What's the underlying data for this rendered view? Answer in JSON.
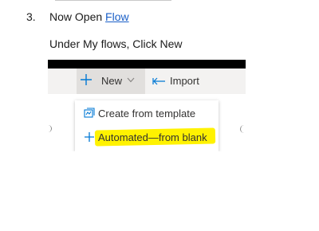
{
  "step": {
    "number": "3.",
    "text_before_link": "Now Open ",
    "link_text": "Flow"
  },
  "instruction": "Under My flows, Click New",
  "screenshot": {
    "toolbar": {
      "new_label": "New",
      "import_label": "Import"
    },
    "menu": {
      "items": [
        {
          "label": "Create from template",
          "icon": "template-icon"
        },
        {
          "label": "Automated—from blank",
          "icon": "plus-icon",
          "highlighted": true
        }
      ]
    },
    "colors": {
      "accent": "#0078d4",
      "highlight": "#fff200"
    }
  }
}
